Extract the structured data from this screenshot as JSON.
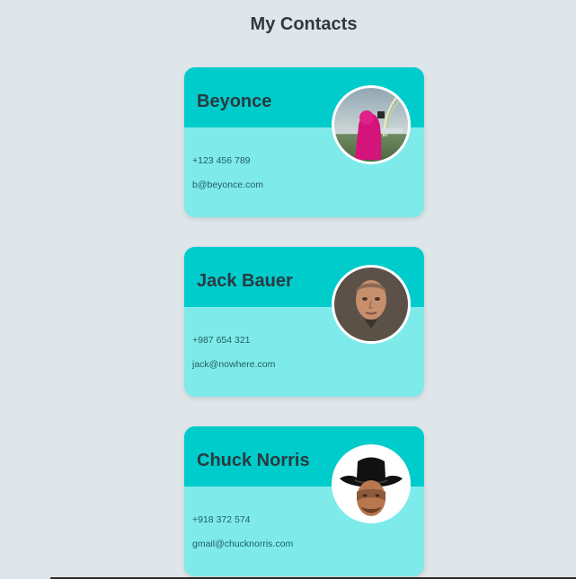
{
  "page": {
    "title": "My Contacts"
  },
  "contacts": [
    {
      "name": "Beyonce",
      "phone": "+123 456 789",
      "email": "b@beyonce.com",
      "avatar": "photo-person-pink-hood-icon"
    },
    {
      "name": "Jack Bauer",
      "phone": "+987 654 321",
      "email": "jack@nowhere.com",
      "avatar": "photo-man-portrait-icon"
    },
    {
      "name": "Chuck Norris",
      "phone": "+918 372 574",
      "email": "gmail@chucknorris.com",
      "avatar": "photo-cowboy-hat-icon"
    }
  ],
  "colors": {
    "background": "#dfe6ea",
    "card_header": "#00cccc",
    "card_body": "#7feaea",
    "text_dark": "#2a3a40"
  }
}
